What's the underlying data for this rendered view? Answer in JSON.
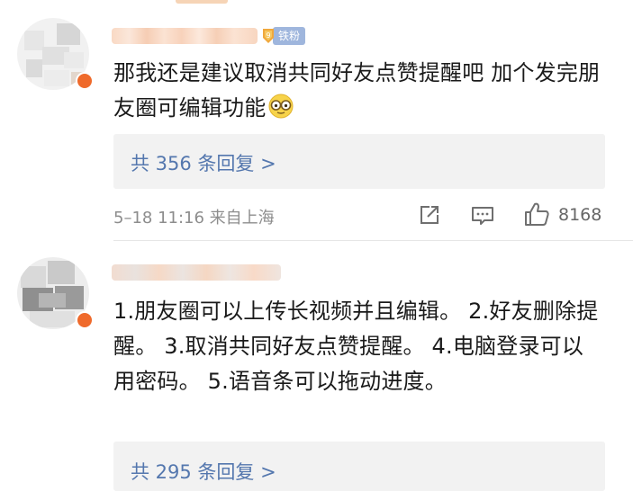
{
  "comments": [
    {
      "fan_badge": "铁粉",
      "text": "那我还是建议取消共同好友点赞提醒吧 加个发完朋友圈可编辑功能",
      "emoji": "glasses-face-emoji",
      "reply_link": "共 356 条回复 >",
      "time_location": "5–18 11:16  来自上海",
      "like_count": "8168"
    },
    {
      "text": "1.朋友圈可以上传长视频并且编辑。 2.好友删除提醒。 3.取消共同好友点赞提醒。 4.电脑登录可以用密码。  5.语音条可以拖动进度。",
      "reply_link": "共 295 条回复 >"
    }
  ],
  "colors": {
    "link": "#5477ae",
    "fan_badge_bg": "#9fb6dd",
    "meta_text": "#8d8d8d",
    "reply_box_bg": "#f2f2f2"
  }
}
